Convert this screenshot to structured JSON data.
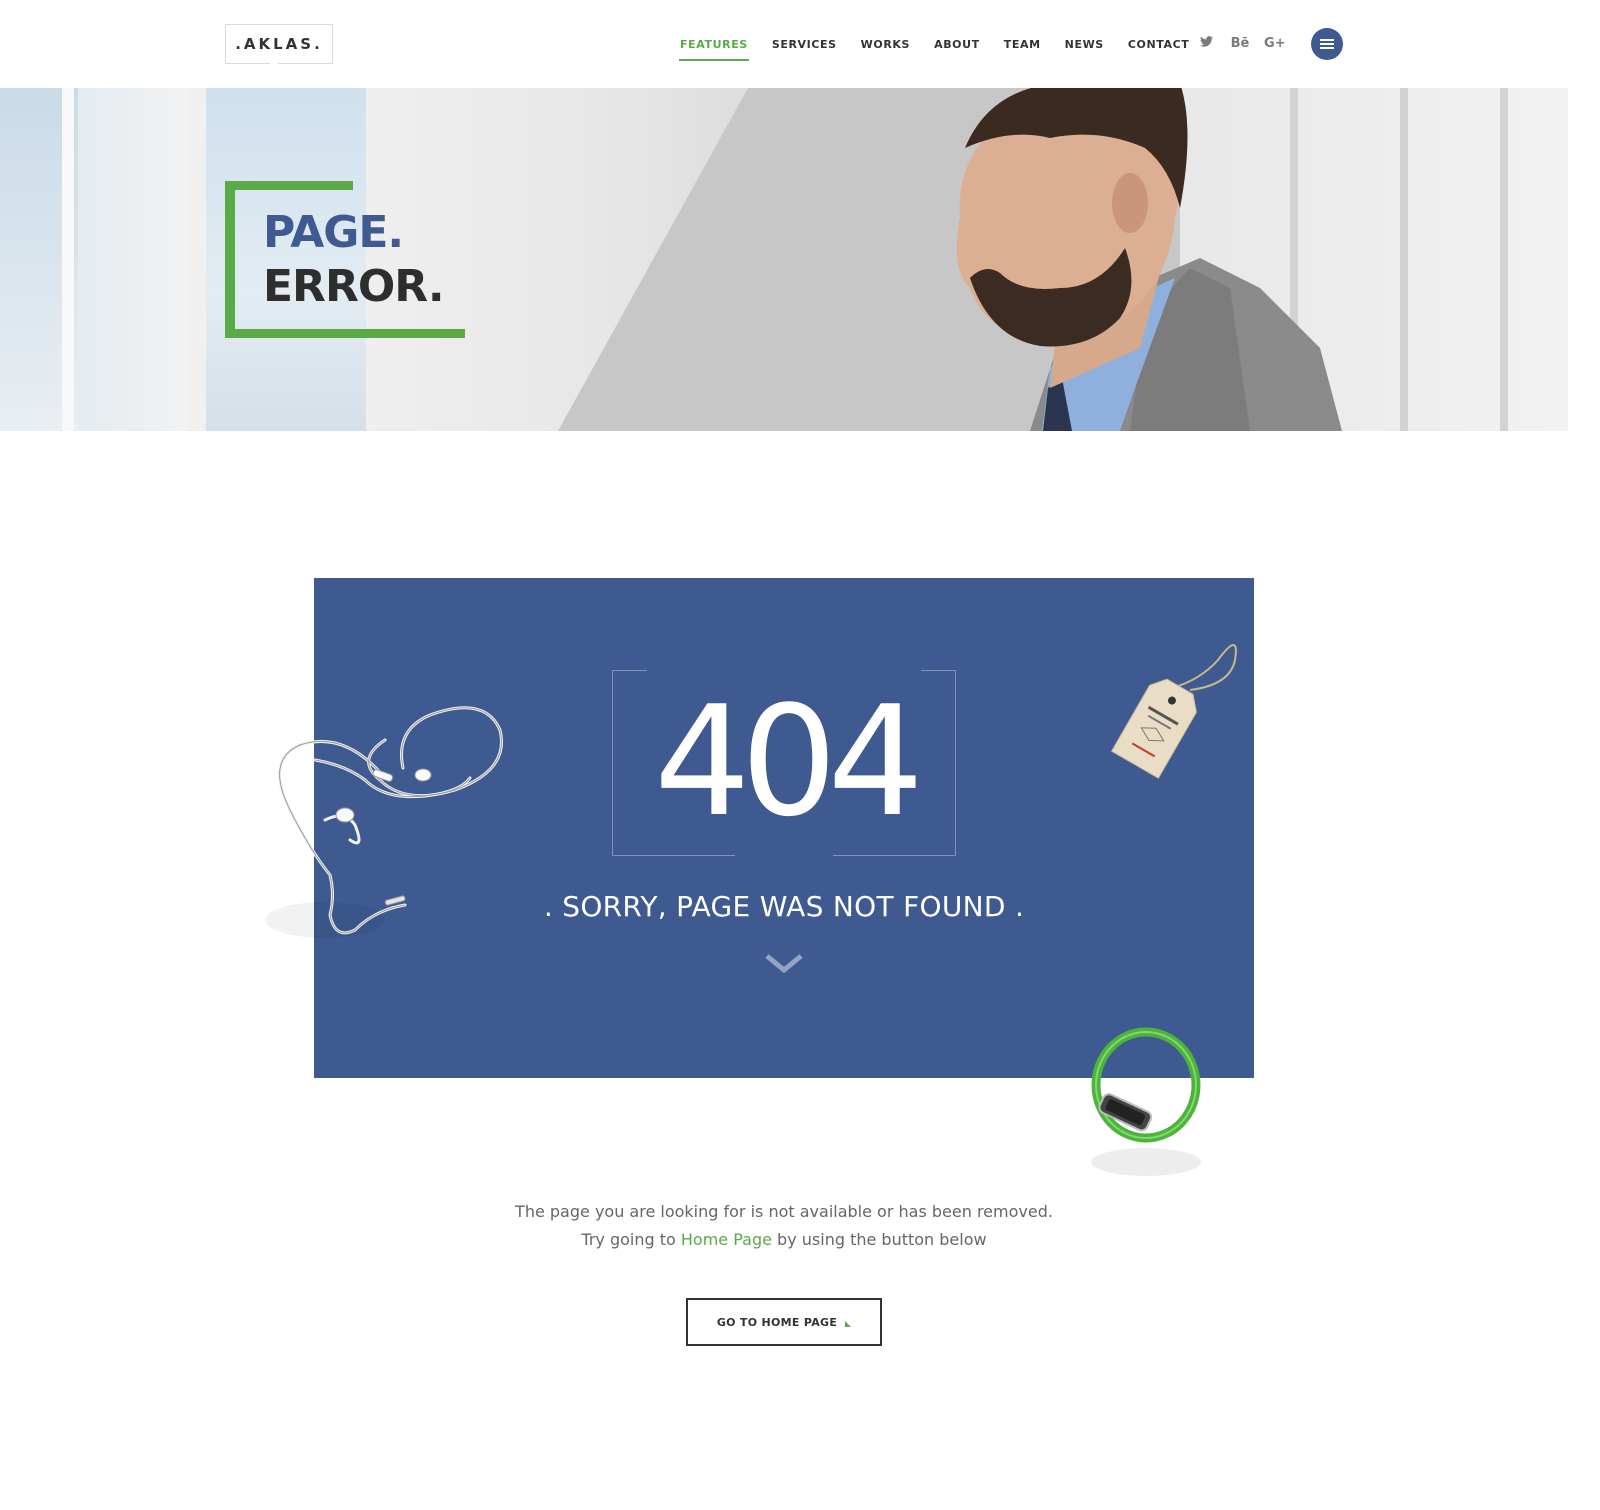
{
  "header": {
    "logo": ".AKLAS.",
    "nav": [
      {
        "label": "FEATURES",
        "active": true
      },
      {
        "label": "SERVICES",
        "active": false
      },
      {
        "label": "WORKS",
        "active": false
      },
      {
        "label": "ABOUT",
        "active": false
      },
      {
        "label": "TEAM",
        "active": false
      },
      {
        "label": "NEWS",
        "active": false
      },
      {
        "label": "CONTACT",
        "active": false
      }
    ],
    "social": [
      {
        "icon": "twitter-icon",
        "glyph": "🐦"
      },
      {
        "icon": "behance-icon",
        "glyph": "Bē"
      },
      {
        "icon": "google-plus-icon",
        "glyph": "G+"
      }
    ],
    "menu_icon": "hamburger-menu-icon"
  },
  "hero": {
    "title_line1": "PAGE.",
    "title_line2": "ERROR."
  },
  "error": {
    "code": "404",
    "message": ". SORRY, PAGE WAS NOT FOUND ."
  },
  "body": {
    "line1": "The page you are looking for is not available or has been removed.",
    "line2_before": "Try going to ",
    "line2_link": "Home Page",
    "line2_after": " by using the button below",
    "button_label": "GO TO HOME PAGE"
  },
  "colors": {
    "brand_blue": "#3e5a91",
    "accent_green": "#5aaa46",
    "text_dark": "#333333"
  }
}
